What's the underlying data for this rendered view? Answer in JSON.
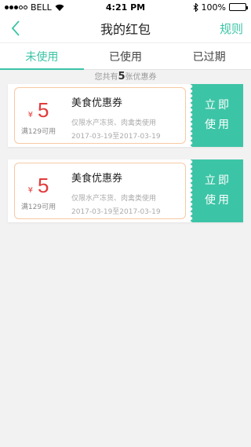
{
  "status_bar": {
    "carrier": "BELL",
    "time": "4:21 PM",
    "battery": "100%"
  },
  "nav": {
    "title": "我的红包",
    "rules_label": "规则"
  },
  "tabs": [
    {
      "label": "未使用",
      "active": true
    },
    {
      "label": "已使用",
      "active": false
    },
    {
      "label": "已过期",
      "active": false
    }
  ],
  "summary": {
    "prefix": "您共有",
    "count": "5",
    "suffix": "张优惠券"
  },
  "coupons": [
    {
      "currency": "¥",
      "amount": "5",
      "condition": "满129可用",
      "name": "美食优惠券",
      "scope": "仅限水产冻货、肉禽类使用",
      "date": "2017-03-19至2017-03-19",
      "action_line1": "立即",
      "action_line2": "使用"
    },
    {
      "currency": "¥",
      "amount": "5",
      "condition": "满129可用",
      "name": "美食优惠券",
      "scope": "仅限水产冻货、肉禽类使用",
      "date": "2017-03-19至2017-03-19",
      "action_line1": "立即",
      "action_line2": "使用"
    }
  ],
  "colors": {
    "accent": "#3cc4a6",
    "amount": "#e23a3a",
    "coupon_border": "#f7c9a3"
  }
}
